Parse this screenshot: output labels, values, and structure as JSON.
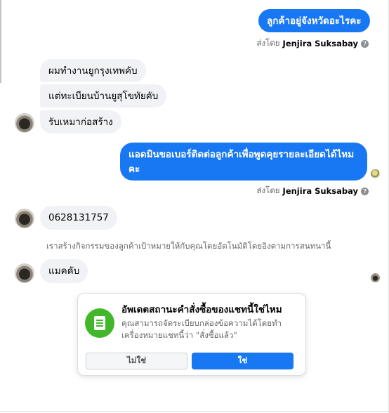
{
  "messages": {
    "out1": "ลูกค้าอยู่จังหวัดอะไรคะ",
    "sent_by_prefix": "ส่งโดย",
    "sent_by_name": "Jenjira Suksabay",
    "in1": "ผมทำงานยูกรุงเทพคับ",
    "in2": "แต่ทะเบียนบ้านยูสุโขทัยคับ",
    "in3": "รับเหมาก่อสร้าง",
    "out2_line1": "แอดมินขอเบอร์ติดต่อลูกค้าเพื่อพูดคุยรายละเอียดได้ไหม",
    "out2_line2": "คะ",
    "in4": "0628131757",
    "system_note": "เราสร้างกิจกรรมของลูกค้าเป้าหมายให้กับคุณโดยอัตโนมัติโดยอิงตามการสนทนานี้",
    "in5": "แมคคับ"
  },
  "prompt_card": {
    "title": "อัพเดตสถานะคำสั่งซื้อของแชทนี้ใช่ไหม",
    "description": "คุณสามารถจัดระเบียบกล่องข้อความได้โดยทำเครื่องหมายแชทนี้ว่า \"สั่งซื้อแล้ว\"",
    "no_label": "ไม่ใช่",
    "yes_label": "ใช่",
    "icon": "order-list-icon",
    "icon_color": "#42b72a"
  },
  "colors": {
    "accent": "#1877f2",
    "incoming_bubble": "#f0f2f5",
    "muted_text": "#65676b"
  }
}
